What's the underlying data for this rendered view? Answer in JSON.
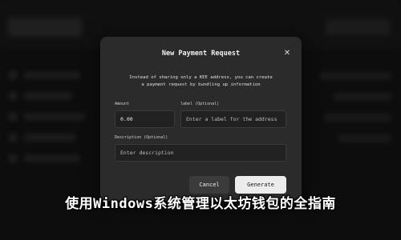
{
  "modal": {
    "title": "New Payment Request",
    "close_icon": "close-icon",
    "description_line1": "Instead of sharing only a KEE address, you can create",
    "description_line2": "a payment request by bundling up information",
    "amount": {
      "label": "Amount",
      "value": "0.00"
    },
    "label_field": {
      "label": "label (Optional)",
      "placeholder": "Enter a label for the address"
    },
    "description_field": {
      "label": "Description (Optional)",
      "placeholder": "Enter description"
    },
    "cancel_label": "Cancel",
    "generate_label": "Generate"
  },
  "headline": "使用Windows系统管理以太坊钱包的全指南"
}
